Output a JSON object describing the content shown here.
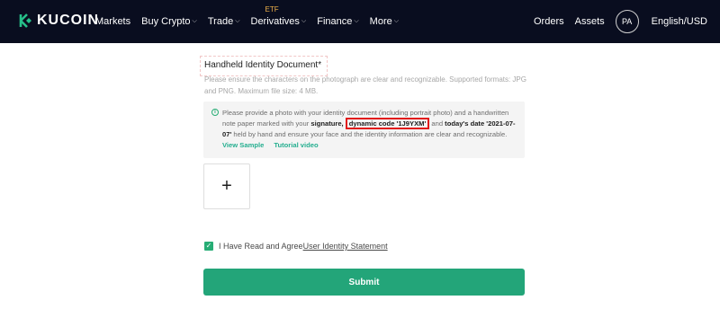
{
  "header": {
    "logo_text": "KUCOIN",
    "nav": [
      {
        "label": "Markets",
        "has_caret": false
      },
      {
        "label": "Buy Crypto",
        "has_caret": true
      },
      {
        "label": "Trade",
        "has_caret": true
      },
      {
        "label": "Derivatives",
        "has_caret": true,
        "badge": "ETF"
      },
      {
        "label": "Finance",
        "has_caret": true
      },
      {
        "label": "More",
        "has_caret": true
      }
    ],
    "orders": "Orders",
    "assets": "Assets",
    "avatar_initials": "PA",
    "language": "English/USD"
  },
  "form": {
    "field_label": "Handheld Identity Document",
    "required_mark": "*",
    "hint": "Please ensure the characters on the photograph are clear and recognizable. Supported formats: JPG and PNG. Maximum file size: 4 MB.",
    "notice": {
      "intro": "Please provide a photo with your identity document (including portrait photo) and a handwritten note paper marked with your ",
      "signature": "signature,",
      "dynamic_code": "dynamic code '1J9YXM'",
      "and_text": " and ",
      "date_text": "today's date '2021-07-07'",
      "outro": " held by hand and ensure your face and the identity information are clear and recognizable.",
      "view_sample": "View Sample",
      "tutorial_video": "Tutorial video"
    },
    "upload_symbol": "+",
    "agree_prefix": "I Have Read and Agree",
    "agree_link": "User Identity Statement",
    "agree_checked": true,
    "submit_label": "Submit"
  },
  "colors": {
    "accent": "#23a579",
    "header_bg": "#090d1f",
    "highlight_border": "#e11919"
  }
}
